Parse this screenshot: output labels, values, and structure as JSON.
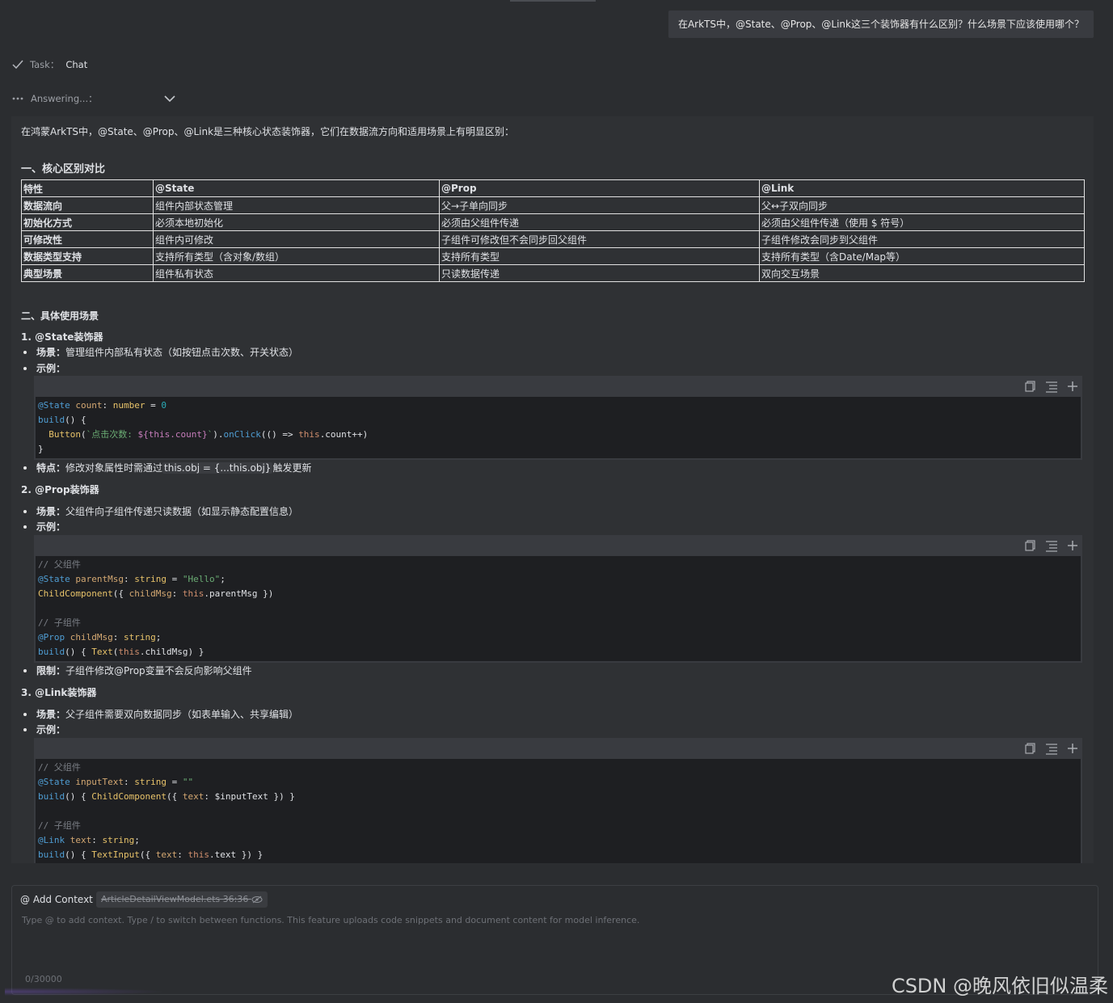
{
  "user_message": "在ArkTS中，@State、@Prop、@Link这三个装饰器有什么区别？什么场景下应该使用哪个？",
  "task": {
    "label": "Task：",
    "value": "Chat"
  },
  "status": {
    "label": "Answering...："
  },
  "answer": {
    "intro": "在鸿蒙ArkTS中，@State、@Prop、@Link是三种核心状态装饰器，它们在数据流方向和适用场景上有明显区别：",
    "section1_title": "一、核心区别对比",
    "table": {
      "headers": [
        "特性",
        "@State",
        "@Prop",
        "@Link"
      ],
      "rows": [
        [
          "数据流向",
          "组件内部状态管理",
          "父→子单向同步",
          "父↔子双向同步"
        ],
        [
          "初始化方式",
          "必须本地初始化",
          "必须由父组件传递",
          "必须由父组件传递（使用 $ 符号）"
        ],
        [
          "可修改性",
          "组件内可修改",
          "子组件可修改但不会同步回父组件",
          "子组件修改会同步到父组件"
        ],
        [
          "数据类型支持",
          "支持所有类型（含对象/数组）",
          "支持所有类型",
          "支持所有类型（含Date/Map等）"
        ],
        [
          "典型场景",
          "组件私有状态",
          "只读数据传递",
          "双向交互场景"
        ]
      ]
    },
    "section2_title": "二、具体使用场景",
    "state": {
      "title": "1. @State装饰器",
      "scene_label": "场景：",
      "scene_text": "管理组件内部私有状态（如按钮点击次数、开关状态）",
      "example_label": "示例：",
      "feature_label": "特点：",
      "feature_pre": "修改对象属性时需通过",
      "feature_code": "this.obj = {...this.obj}",
      "feature_post": "触发更新"
    },
    "prop": {
      "title": "2. @Prop装饰器",
      "scene_label": "场景：",
      "scene_text": "父组件向子组件传递只读数据（如显示静态配置信息）",
      "example_label": "示例：",
      "limit_label": "限制：",
      "limit_text": "子组件修改@Prop变量不会反向影响父组件"
    },
    "link": {
      "title": "3. @Link装饰器",
      "scene_label": "场景：",
      "scene_text": "父子组件需要双向数据同步（如表单输入、共享编辑）",
      "example_label": "示例："
    },
    "code1": {
      "l1_ann": "@State",
      "l1_var": "count",
      "l1_type": "number",
      "l1_num": "0",
      "l2": "build",
      "l3_fn": "Button",
      "l3_str": "`点击次数: ",
      "l3_tpl": "${this.count}",
      "l3_end": "`",
      "l3_click": "onClick",
      "l3_kw": "this",
      "l3_rest": ".count++)"
    },
    "code2": {
      "c1": "// 父组件",
      "l1_ann": "@State",
      "l1_var": "parentMsg",
      "l1_type": "string",
      "l1_str": "\"Hello\"",
      "l2_fn": "ChildComponent",
      "l2_field": "childMsg",
      "l2_kw": "this",
      "l2_rest": ".parentMsg })",
      "c2": "// 子组件",
      "l3_ann": "@Prop",
      "l3_var": "childMsg",
      "l3_type": "string",
      "l4_build": "build",
      "l4_fn": "Text",
      "l4_kw": "this",
      "l4_rest": ".childMsg) }"
    },
    "code3": {
      "c1": "// 父组件",
      "l1_ann": "@State",
      "l1_var": "inputText",
      "l1_type": "string",
      "l1_str": "\"\"",
      "l2_build": "build",
      "l2_fn": "ChildComponent",
      "l2_field": "text",
      "l2_rest": "$inputText }) }",
      "c2": "// 子组件",
      "l3_ann": "@Link",
      "l3_var": "text",
      "l3_type": "string",
      "l4_build": "build",
      "l4_fn": "TextInput",
      "l4_field": "text",
      "l4_kw": "this",
      "l4_rest": ".text }) }"
    }
  },
  "input": {
    "add_context": "@ Add Context",
    "context_file": "ArticleDetailViewModel.ets 36:36",
    "placeholder": "Type @ to add context. Type / to switch between functions. This feature uploads code snippets and document content for model inference.",
    "counter": "0/30000"
  },
  "watermark": "CSDN @晚风依旧似温柔",
  "icons": [
    "check-icon",
    "dots-icon",
    "chevron-down-icon",
    "copy-icon",
    "format-icon",
    "insert-icon",
    "eye-off-icon"
  ]
}
